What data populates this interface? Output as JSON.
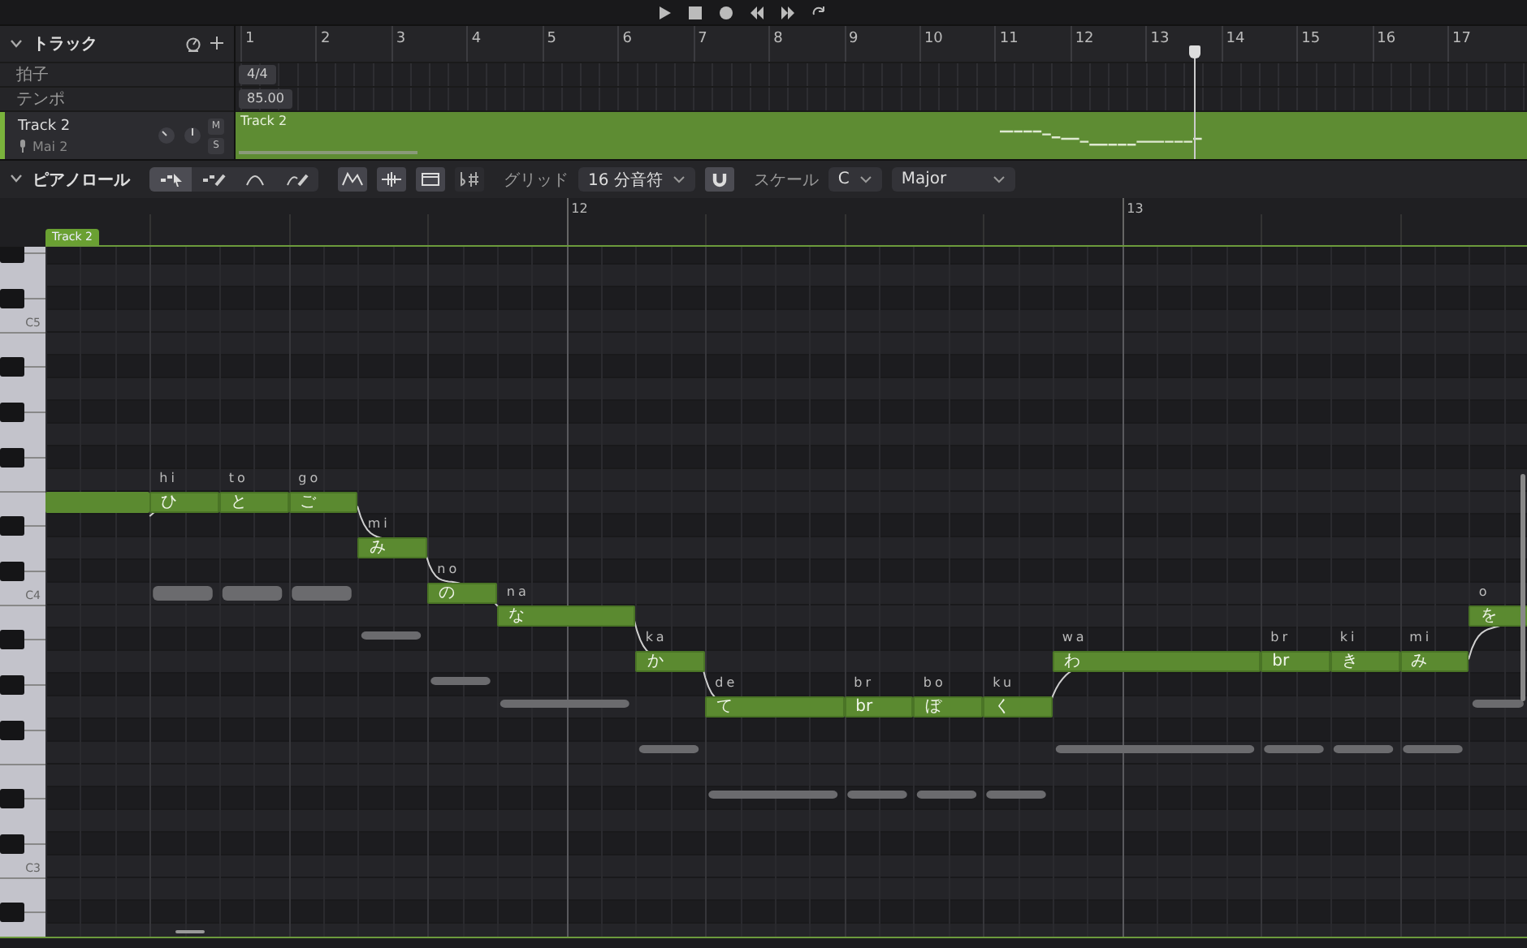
{
  "track_panel": {
    "title": "トラック",
    "expanded": true,
    "meta_rows": [
      {
        "label": "拍子",
        "value": "4/4"
      },
      {
        "label": "テンポ",
        "value": "85.00"
      }
    ],
    "ruler": [
      "1",
      "2",
      "3",
      "4",
      "5",
      "6",
      "7",
      "8",
      "9",
      "10",
      "11",
      "12",
      "13",
      "14",
      "15",
      "16",
      "17"
    ],
    "track": {
      "name": "Track 2",
      "singer": "Mai 2",
      "mute_label": "M",
      "mute": false,
      "solo_label": "S",
      "solo": false,
      "selected": true,
      "clip_label": "Track 2"
    }
  },
  "piano_roll": {
    "title": "ピアノロール",
    "expanded": true,
    "tools": [
      {
        "kind": "select",
        "selected": true
      },
      {
        "kind": "draw",
        "selected": false
      },
      {
        "kind": "curve",
        "selected": false
      },
      {
        "kind": "pen",
        "selected": false
      }
    ],
    "toggles": [
      {
        "kind": "pitch",
        "on": true
      },
      {
        "kind": "wave",
        "on": true
      },
      {
        "kind": "panel",
        "on": true
      },
      {
        "kind": "accidental",
        "on": false
      }
    ],
    "grid_label": "グリッド",
    "grid_value": "16 分音符",
    "snap": true,
    "scale_label": "スケール",
    "scale_key": "C",
    "scale_mode": "Major",
    "ruler": [
      "12",
      "13"
    ],
    "clip_tab": "Track 2",
    "octave_labels": [
      "C5",
      "C4",
      "C3"
    ],
    "notes": [
      {
        "kind": "blank"
      },
      {
        "lyric": "ひ",
        "phoneme": "hi"
      },
      {
        "lyric": "と",
        "phoneme": "to"
      },
      {
        "lyric": "ご",
        "phoneme": "go"
      },
      {
        "lyric": "み",
        "phoneme": "mi"
      },
      {
        "lyric": "の",
        "phoneme": "no"
      },
      {
        "lyric": "な",
        "phoneme": "na"
      },
      {
        "lyric": "か",
        "phoneme": "ka"
      },
      {
        "lyric": "て",
        "phoneme": "de"
      },
      {
        "lyric": "br",
        "phoneme": "br"
      },
      {
        "lyric": "ぼ",
        "phoneme": "bo"
      },
      {
        "lyric": "く",
        "phoneme": "ku"
      },
      {
        "lyric": "わ",
        "phoneme": "wa"
      },
      {
        "lyric": "br",
        "phoneme": "br"
      },
      {
        "lyric": "き",
        "phoneme": "ki"
      },
      {
        "lyric": "み",
        "phoneme": "mi"
      },
      {
        "lyric": "を",
        "phoneme": "o"
      }
    ]
  }
}
